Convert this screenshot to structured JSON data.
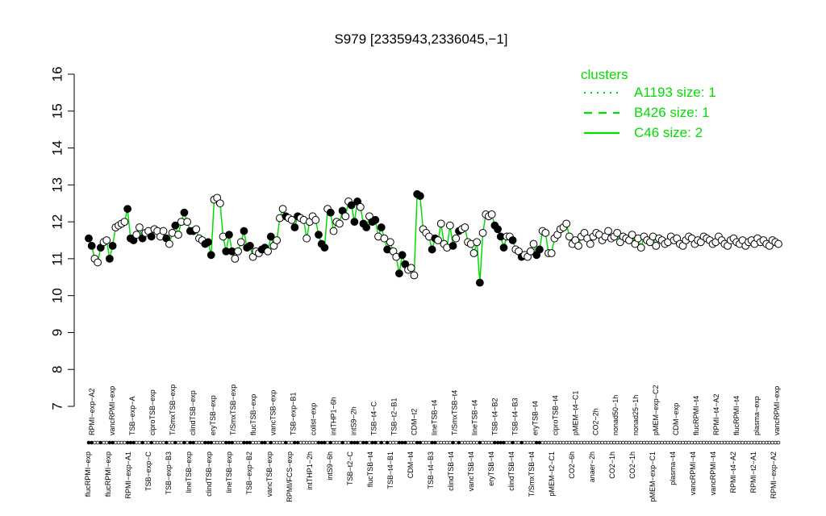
{
  "chart_data": {
    "type": "line",
    "title": "S979 [2335943,2336045,−1]",
    "xlabel": "",
    "ylabel": "",
    "ylim": [
      7,
      16
    ],
    "yticks": [
      7,
      8,
      9,
      10,
      11,
      12,
      13,
      14,
      15,
      16
    ],
    "grid": false,
    "legend": {
      "title": "clusters",
      "placement": "top-right",
      "color": "#00dd00",
      "entries": [
        {
          "label": "A1193 size: 1",
          "style": "dotted"
        },
        {
          "label": "B426 size: 1",
          "style": "dashed"
        },
        {
          "label": "C46 size: 2",
          "style": "solid"
        }
      ]
    },
    "top_labels": [
      "RPMI−exp−A2",
      "vancRPMI−exp",
      "TSB−exp−A",
      "ciproTSB−exp",
      "T/SmxTSB−exp",
      "clindTSB−exp",
      "eryTSB−exp",
      "T/SmxTSB−exp",
      "flucTSB−exp",
      "vancTSB−exp",
      "TSB−exp−B1",
      "colist−exp",
      "intTHP1−6h",
      "intS9−2h",
      "TSB−t4−C",
      "TSB−t2−B1",
      "CDM−t2",
      "lineTSB−t4",
      "T/SmxTSB−t4",
      "lineTSB−t4",
      "TSB−t4−B2",
      "TSB−t4−B3",
      "eryTSB−t4",
      "ciproTSB−t4",
      "pMEM−t4−C1",
      "CO2−2h",
      "nonad50−1h",
      "nonad25−1h",
      "pMEM−exp−C2",
      "CDM−exp",
      "flucRPMI−t4",
      "RPMI−t4−A2",
      "flucRPMI−t4",
      "plasma−exp",
      "vancRPMI−exp"
    ],
    "bottom_labels": [
      "flucRPMI−exp",
      "flucRPMI−exp",
      "RPMI−exp−A1",
      "TSB−exp−C",
      "TSB−exp−B3",
      "lineTSB−exp",
      "clindTSB−exp",
      "lineTSB−exp",
      "TSB−exp−B2",
      "vancTSB−exp",
      "RPMI/FCS−exp",
      "intTHP1−2h",
      "intS9−6h",
      "TSB−t2−C",
      "flucTSB−t4",
      "TSB−t4−B1",
      "CDM−t4",
      "TSB−t4−B3",
      "clindTSB−t4",
      "vancTSB−t4",
      "eryTSB−t4",
      "clindTSB−t4",
      "T/SmxTSB−t4",
      "pMEM−t2−C1",
      "CO2−6h",
      "anaer−2h",
      "CO2−1h",
      "CO2−1h",
      "pMEM−exp−C1",
      "plasma−t4",
      "vancRPMI−t4",
      "vancRPMI−t4",
      "RPMI−t4−A2",
      "RPMI−t2−A1",
      "RPMI−exp−A2"
    ],
    "x": [
      1,
      2,
      3,
      4,
      5,
      6,
      7,
      8,
      9,
      10,
      11,
      12,
      13,
      14,
      15,
      16,
      17,
      18,
      19,
      20,
      21,
      22,
      23,
      24,
      25,
      26,
      27,
      28,
      29,
      30,
      31,
      32,
      33,
      34,
      35,
      36,
      37,
      38,
      39,
      40,
      41,
      42,
      43,
      44,
      45,
      46,
      47,
      48,
      49,
      50,
      51,
      52,
      53,
      54,
      55,
      56,
      57,
      58,
      59,
      60,
      61,
      62,
      63,
      64,
      65,
      66,
      67,
      68,
      69,
      70,
      71,
      72,
      73,
      74,
      75,
      76,
      77,
      78,
      79,
      80,
      81,
      82,
      83,
      84,
      85,
      86,
      87,
      88,
      89,
      90,
      91,
      92,
      93,
      94,
      95,
      96,
      97,
      98,
      99,
      100,
      101,
      102,
      103,
      104,
      105,
      106,
      107,
      108,
      109,
      110,
      111,
      112,
      113,
      114,
      115,
      116,
      117,
      118,
      119,
      120,
      121,
      122,
      123,
      124,
      125,
      126,
      127,
      128,
      129,
      130,
      131,
      132,
      133,
      134,
      135,
      136,
      137,
      138,
      139,
      140,
      141,
      142,
      143,
      144,
      145,
      146,
      147,
      148,
      149,
      150,
      151,
      152,
      153,
      154,
      155,
      156,
      157,
      158,
      159,
      160,
      161,
      162,
      163,
      164,
      165,
      166,
      167,
      168,
      169,
      170,
      171,
      172,
      173,
      174,
      175,
      176,
      177,
      178,
      179,
      180,
      181,
      182,
      183,
      184,
      185,
      186,
      187,
      188,
      189,
      190,
      191,
      192,
      193,
      194,
      195,
      196,
      197,
      198,
      199,
      200,
      201,
      202,
      203,
      204,
      205,
      206,
      207,
      208,
      209,
      210,
      211,
      212,
      213,
      214,
      215,
      216,
      217,
      218,
      219,
      220,
      221,
      222,
      223,
      224,
      225,
      226,
      227,
      228,
      229,
      230,
      231
    ],
    "series": [
      {
        "values": [
          11.55,
          11.35,
          11.0,
          10.9,
          11.3,
          11.45,
          11.5,
          11.0,
          11.35,
          11.85,
          11.9,
          11.95,
          12.0,
          12.35,
          11.55,
          11.5,
          11.65,
          11.85,
          11.55,
          11.7,
          11.75,
          11.6,
          11.8,
          11.75,
          11.6,
          11.75,
          11.55,
          11.4,
          11.7,
          11.9,
          11.65,
          12.0,
          12.25,
          12.0,
          11.75,
          11.75,
          11.8,
          11.55,
          11.5,
          11.4,
          11.45,
          11.1,
          12.6,
          12.65,
          12.5,
          11.6,
          11.2,
          11.65,
          11.2,
          11.0,
          11.2,
          11.45,
          11.75,
          11.3,
          11.35,
          11.05,
          11.2,
          11.15,
          11.25,
          11.3,
          11.2,
          11.6,
          11.35,
          11.5,
          12.1,
          12.35,
          12.15,
          12.1,
          12.05,
          11.85,
          12.15,
          12.1,
          12.05,
          11.55,
          12.0,
          12.15,
          12.05,
          11.65,
          11.4,
          11.3,
          12.35,
          12.25,
          11.75,
          12.0,
          11.95,
          12.3,
          12.15,
          12.55,
          12.45,
          12.0,
          12.55,
          12.4,
          11.95,
          11.85,
          12.15,
          12.0,
          12.05,
          11.6,
          11.85,
          11.55,
          11.25,
          11.45,
          11.2,
          11.05,
          10.6,
          11.1,
          10.85,
          10.7,
          10.75,
          10.55,
          12.75,
          12.7,
          11.8,
          11.7,
          11.6,
          11.25,
          11.55,
          11.5,
          11.95,
          11.4,
          11.3,
          11.9,
          11.35,
          11.55,
          11.75,
          11.8,
          11.85,
          11.45,
          11.4,
          11.15,
          11.45,
          10.35,
          11.7,
          12.2,
          12.15,
          12.2,
          11.9,
          11.8,
          11.6,
          11.3,
          11.6,
          11.6,
          11.5,
          11.25,
          11.2,
          11.05,
          11.1,
          11.05,
          11.2,
          11.4,
          11.1,
          11.25,
          11.75,
          11.7,
          11.15,
          11.15,
          11.55,
          11.65,
          11.8,
          11.85,
          11.95,
          11.6,
          11.4,
          11.5,
          11.35,
          11.6,
          11.7,
          11.55,
          11.4,
          11.6,
          11.7,
          11.65,
          11.5,
          11.6,
          11.75,
          11.55,
          11.6,
          11.7,
          11.45,
          11.6,
          11.55,
          11.5,
          11.65,
          11.4,
          11.55,
          11.3,
          11.6,
          11.5,
          11.45,
          11.6,
          11.35,
          11.55,
          11.5,
          11.4,
          11.45,
          11.6,
          11.5,
          11.55,
          11.4,
          11.35,
          11.5,
          11.6,
          11.55,
          11.4,
          11.5,
          11.45,
          11.6,
          11.55,
          11.5,
          11.4,
          11.45,
          11.6,
          11.5,
          11.4,
          11.35,
          11.5,
          11.55,
          11.45,
          11.4,
          11.5,
          11.35,
          11.45,
          11.5,
          11.4,
          11.55,
          11.45,
          11.5,
          11.4,
          11.35,
          11.5,
          11.45,
          11.4
        ],
        "filled": [
          true,
          true,
          false,
          false,
          true,
          false,
          false,
          true,
          true,
          false,
          false,
          false,
          false,
          true,
          true,
          true,
          false,
          false,
          true,
          false,
          false,
          true,
          false,
          false,
          false,
          false,
          true,
          false,
          false,
          true,
          false,
          false,
          true,
          false,
          true,
          true,
          false,
          false,
          false,
          true,
          true,
          true,
          false,
          false,
          false,
          false,
          true,
          true,
          true,
          false,
          false,
          false,
          true,
          true,
          true,
          false,
          false,
          false,
          true,
          true,
          false,
          true,
          false,
          false,
          false,
          false,
          true,
          false,
          false,
          true,
          true,
          false,
          false,
          false,
          false,
          false,
          false,
          true,
          true,
          true,
          false,
          true,
          false,
          false,
          false,
          true,
          false,
          false,
          true,
          true,
          true,
          false,
          true,
          true,
          false,
          true,
          true,
          false,
          true,
          false,
          true,
          false,
          false,
          false,
          true,
          true,
          true,
          false,
          false,
          false,
          true,
          true,
          false,
          false,
          false,
          true,
          true,
          false,
          false,
          false,
          false,
          false,
          true,
          false,
          true,
          false,
          false,
          false,
          false,
          false,
          false,
          true,
          false,
          false,
          false,
          false,
          true,
          true,
          true,
          true,
          false,
          false,
          true,
          false,
          false,
          true,
          false,
          false,
          false,
          false,
          true,
          true,
          false,
          false,
          false,
          false,
          false,
          false,
          false,
          false,
          false,
          false,
          false,
          false,
          false,
          false,
          false,
          false,
          false,
          false,
          false,
          false,
          false,
          false,
          false,
          false,
          false,
          false,
          false,
          false,
          false,
          false,
          false,
          false,
          false,
          false,
          false,
          false,
          false,
          false,
          false,
          false,
          false,
          false,
          false,
          false,
          false,
          false,
          false,
          false,
          false,
          false,
          false,
          false,
          false,
          false,
          false,
          false,
          false,
          false,
          false,
          false,
          false,
          false,
          false,
          false,
          false,
          false,
          false,
          false,
          false,
          false,
          false,
          false,
          false,
          false,
          false,
          false,
          false,
          false,
          false,
          false,
          false,
          false,
          false,
          false,
          false
        ]
      }
    ]
  }
}
